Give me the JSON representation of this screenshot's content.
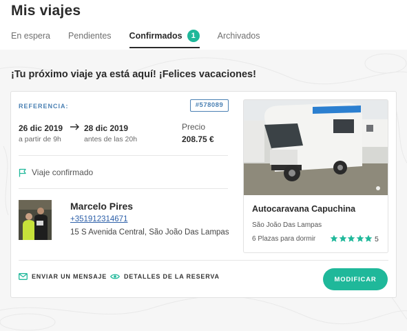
{
  "header": {
    "title": "Mis viajes",
    "tabs": [
      {
        "label": "En espera"
      },
      {
        "label": "Pendientes"
      },
      {
        "label": "Confirmados",
        "badge": "1"
      },
      {
        "label": "Archivados"
      }
    ]
  },
  "greeting": "¡Tu próximo viaje ya está aquí! ¡Felices vacaciones!",
  "booking": {
    "reference_label": "REFERENCIA:",
    "reference_code": "#578089",
    "start_date": "26 dic 2019",
    "start_sub": "a partir de 9h",
    "end_date": "28 dic 2019",
    "end_sub": "antes de las 20h",
    "price_label": "Precio",
    "price_value": "208.75 €",
    "status": "Viaje confirmado"
  },
  "host": {
    "name": "Marcelo Pires",
    "phone": "+351912314671",
    "address": "15 S Avenida Central, São João Das Lampas"
  },
  "vehicle": {
    "name": "Autocaravana Capuchina",
    "location": "São João Das Lampas",
    "beds": "6 Plazas para dormir",
    "stars": 5,
    "rating": "5"
  },
  "actions": {
    "message": "ENVIAR UN MENSAJE",
    "details": "DETALLES DE LA RESERVA",
    "modify": "MODIFICAR"
  },
  "colors": {
    "accent": "#1fb89a",
    "link": "#2c5fa8",
    "reference": "#4a80b3"
  }
}
